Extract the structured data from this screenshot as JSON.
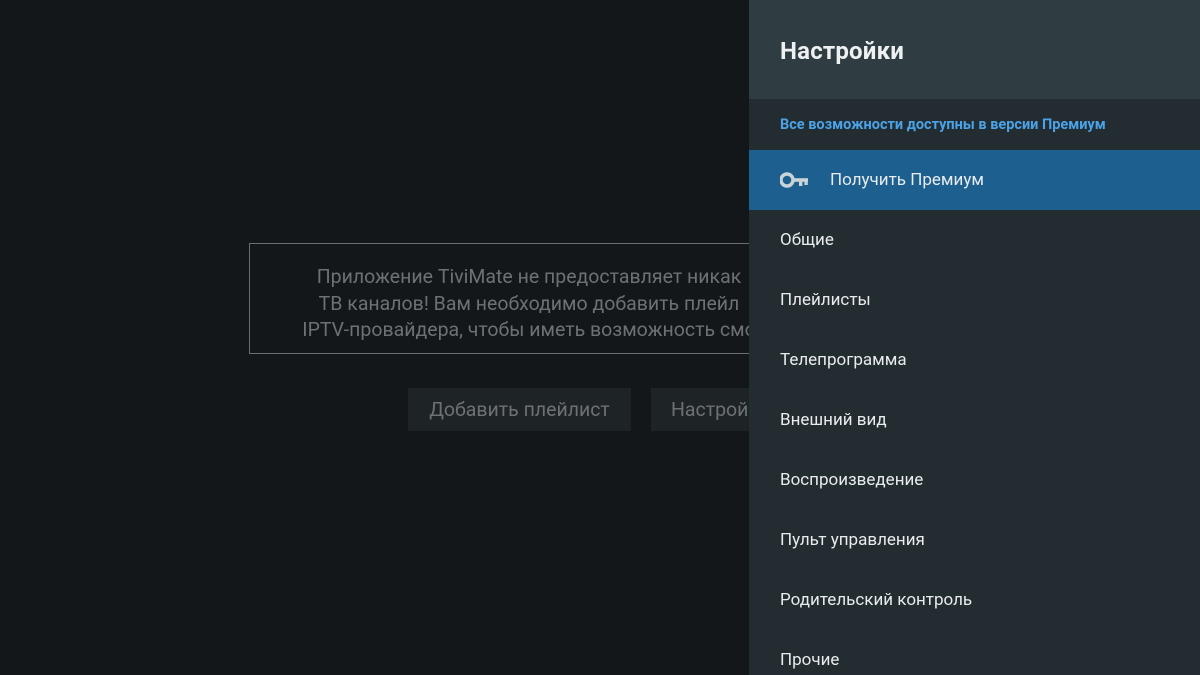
{
  "background": {
    "message_lines": [
      "Приложение TiviMate не предоставляет никак",
      "ТВ каналов! Вам необходимо добавить плейл",
      "IPTV-провайдера, чтобы иметь возможность смо"
    ],
    "add_playlist_label": "Добавить плейлист",
    "settings_label": "Настрой"
  },
  "panel": {
    "title": "Настройки",
    "premium_note": "Все возможности доступны в версии Премиум",
    "items": [
      {
        "label": "Получить Премиум",
        "icon": "key-icon",
        "selected": true
      },
      {
        "label": "Общие"
      },
      {
        "label": "Плейлисты"
      },
      {
        "label": "Телепрограмма"
      },
      {
        "label": "Внешний вид"
      },
      {
        "label": "Воспроизведение"
      },
      {
        "label": "Пульт управления"
      },
      {
        "label": "Родительский контроль"
      },
      {
        "label": "Прочие"
      }
    ]
  },
  "colors": {
    "accent": "#4aa3e8",
    "selected_bg": "#1d5f8f",
    "panel_bg": "#232c30",
    "header_bg": "#2f3d43"
  }
}
